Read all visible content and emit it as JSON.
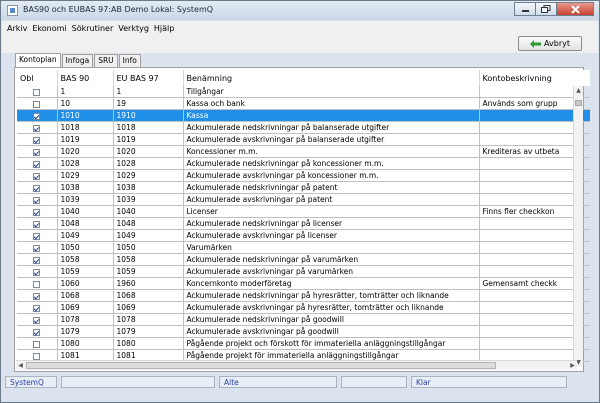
{
  "window": {
    "title": "BAS90 och EUBAS 97:AB Demo Lokal: SystemQ"
  },
  "menu": [
    {
      "label": "Arkiv"
    },
    {
      "label": "Ekonomi"
    },
    {
      "label": "Sökrutiner"
    },
    {
      "label": "Verktyg"
    },
    {
      "label": "Hjälp"
    }
  ],
  "toolbar": {
    "cancel_label": "Avbryt"
  },
  "tabs": [
    {
      "label": "Kontoplan",
      "active": true
    },
    {
      "label": "Infoga",
      "active": false
    },
    {
      "label": "SRU",
      "active": false
    },
    {
      "label": "Info",
      "active": false
    }
  ],
  "table": {
    "columns": [
      "Obl",
      "BAS 90",
      "EU BAS 97",
      "Benämning",
      "Kontobeskrivning"
    ],
    "rows": [
      {
        "obl": false,
        "bas90": "1",
        "eubas97": "1",
        "name": "Tillgångar",
        "desc": ""
      },
      {
        "obl": false,
        "bas90": "10",
        "eubas97": "19",
        "name": "Kassa och bank",
        "desc": "Används som grupp"
      },
      {
        "obl": true,
        "bas90": "1010",
        "eubas97": "1910",
        "name": "Kassa",
        "desc": "",
        "selected": true
      },
      {
        "obl": true,
        "bas90": "1018",
        "eubas97": "1018",
        "name": "Ackumulerade nedskrivningar på balanserade utgifter",
        "desc": ""
      },
      {
        "obl": true,
        "bas90": "1019",
        "eubas97": "1019",
        "name": "Ackumulerade avskrivningar på balanserade utgifter",
        "desc": ""
      },
      {
        "obl": true,
        "bas90": "1020",
        "eubas97": "1020",
        "name": "Koncessioner m.m.",
        "desc": "Krediteras av utbeta"
      },
      {
        "obl": true,
        "bas90": "1028",
        "eubas97": "1028",
        "name": "Ackumulerade nedskrivningar på koncessioner m.m.",
        "desc": ""
      },
      {
        "obl": true,
        "bas90": "1029",
        "eubas97": "1029",
        "name": "Ackumulerade avskrivningar på koncessioner m.m.",
        "desc": ""
      },
      {
        "obl": true,
        "bas90": "1038",
        "eubas97": "1038",
        "name": "Ackumulerade nedskrivningar på patent",
        "desc": ""
      },
      {
        "obl": true,
        "bas90": "1039",
        "eubas97": "1039",
        "name": "Ackumulerade avskrivningar på patent",
        "desc": ""
      },
      {
        "obl": true,
        "bas90": "1040",
        "eubas97": "1040",
        "name": "Licenser",
        "desc": "Finns fler checkkon"
      },
      {
        "obl": true,
        "bas90": "1048",
        "eubas97": "1048",
        "name": "Ackumulerade nedskrivningar på licenser",
        "desc": ""
      },
      {
        "obl": true,
        "bas90": "1049",
        "eubas97": "1049",
        "name": "Ackumulerade avskrivningar på licenser",
        "desc": ""
      },
      {
        "obl": true,
        "bas90": "1050",
        "eubas97": "1050",
        "name": "Varumärken",
        "desc": ""
      },
      {
        "obl": true,
        "bas90": "1058",
        "eubas97": "1058",
        "name": "Ackumulerade nedskrivningar på varumärken",
        "desc": ""
      },
      {
        "obl": true,
        "bas90": "1059",
        "eubas97": "1059",
        "name": "Ackumulerade avskrivningar på varumärken",
        "desc": ""
      },
      {
        "obl": false,
        "bas90": "1060",
        "eubas97": "1960",
        "name": "Koncernkonto moderföretag",
        "desc": "Gemensamt checkk"
      },
      {
        "obl": true,
        "bas90": "1068",
        "eubas97": "1068",
        "name": "Ackumulerade nedskrivningar på hyresrätter, tomträtter och liknande",
        "desc": ""
      },
      {
        "obl": true,
        "bas90": "1069",
        "eubas97": "1069",
        "name": "Ackumulerade avskrivningar på hyresrätter, tomträtter och liknande",
        "desc": ""
      },
      {
        "obl": true,
        "bas90": "1078",
        "eubas97": "1078",
        "name": "Ackumulerade nedskrivningar på goodwill",
        "desc": ""
      },
      {
        "obl": true,
        "bas90": "1079",
        "eubas97": "1079",
        "name": "Ackumulerade avskrivningar på goodwill",
        "desc": ""
      },
      {
        "obl": false,
        "bas90": "1080",
        "eubas97": "1080",
        "name": "Pågående projekt och förskott för immateriella anläggningstillgångar",
        "desc": ""
      },
      {
        "obl": false,
        "bas90": "1081",
        "eubas97": "1081",
        "name": "Pågående projekt för immateriella anläggningstillgångar",
        "desc": ""
      }
    ]
  },
  "status": [
    "SystemQ",
    "",
    "Alte",
    "",
    "Klar"
  ],
  "colors": {
    "selection": "#1f8fe8",
    "status_text": "#2a3fa8"
  }
}
